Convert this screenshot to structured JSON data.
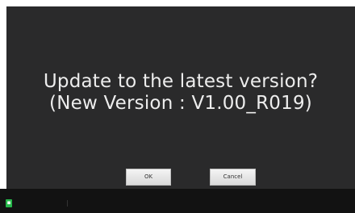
{
  "dialog": {
    "message_line1": "Update to the latest version?",
    "message_line2": "(New Version : V1.00_R019)",
    "ok_label": "OK",
    "cancel_label": "Cancel"
  },
  "bottom_bar": {
    "status_icon": "green-status-icon",
    "status_icon_color": "#27b84b"
  }
}
